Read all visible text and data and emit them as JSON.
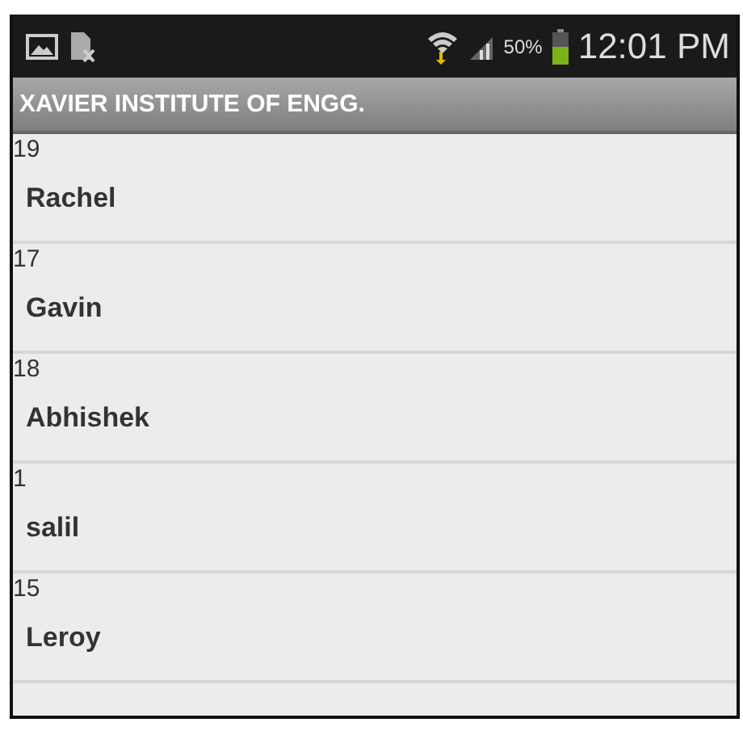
{
  "status_bar": {
    "battery_text": "50%",
    "time": "12:01 PM"
  },
  "app_bar": {
    "title": "XAVIER INSTITUTE OF ENGG."
  },
  "students": [
    {
      "number": "19",
      "name": "Rachel"
    },
    {
      "number": "17",
      "name": "Gavin"
    },
    {
      "number": "18",
      "name": "Abhishek"
    },
    {
      "number": "1",
      "name": "salil"
    },
    {
      "number": "15",
      "name": "Leroy"
    }
  ]
}
